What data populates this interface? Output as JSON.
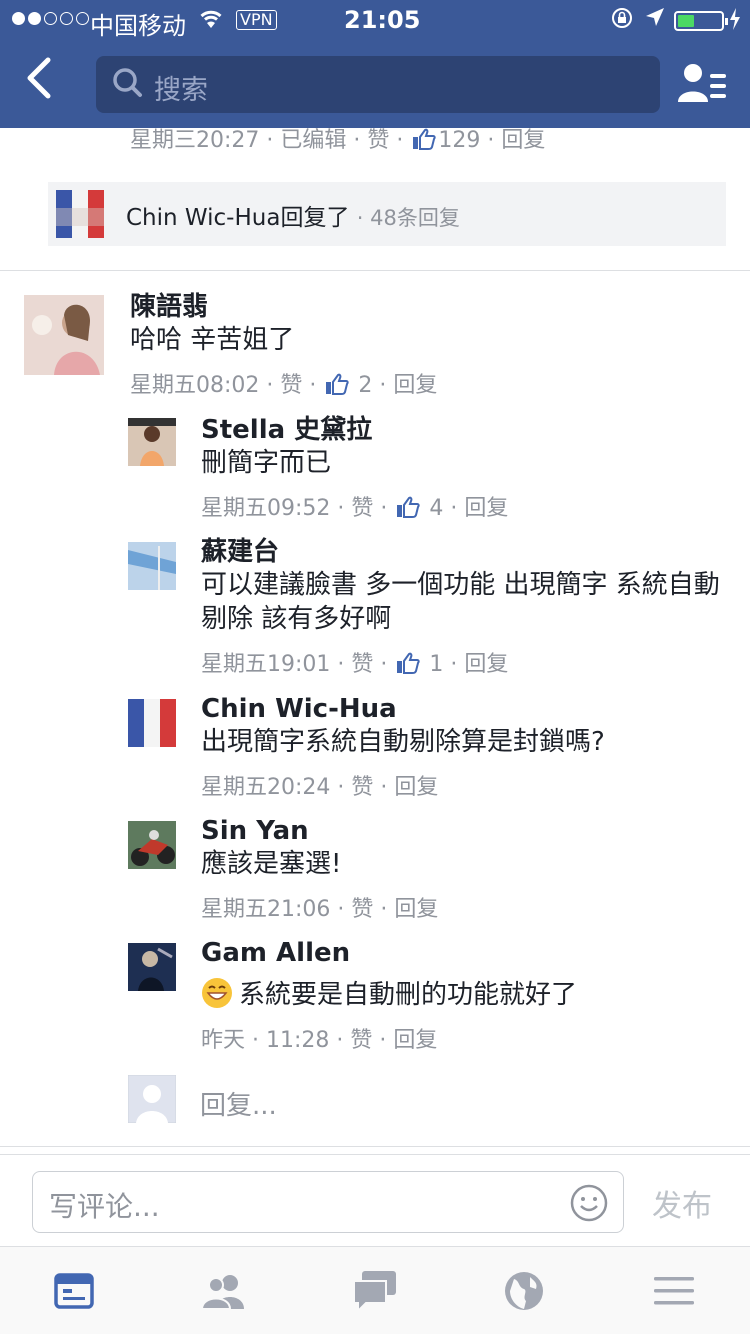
{
  "status_bar": {
    "carrier": "中国移动",
    "vpn": "VPN",
    "time": "21:05",
    "battery_level": 0.3,
    "signal_bars_filled": 2,
    "signal_bars_total": 5
  },
  "header": {
    "back_icon": "chevron-left-icon",
    "search_placeholder": "搜索",
    "friend_requests_icon": "friend-requests-icon"
  },
  "top_comment_meta": {
    "time": "星期三20:27",
    "edited": "已编辑",
    "like": "赞",
    "likes": "129",
    "reply": "回复",
    "sep": " · "
  },
  "collapsed_reply": {
    "name": "Chin Wic-Hua",
    "action": "回复了",
    "count": "48条回复"
  },
  "comments": [
    {
      "name": "陳語翡",
      "text": "哈哈 辛苦姐了",
      "time": "星期五08:02",
      "like": "赞",
      "likes": "2",
      "reply": "回复"
    },
    {
      "name": "Stella 史黛拉",
      "text": "刪簡字而已",
      "time": "星期五09:52",
      "like": "赞",
      "likes": "4",
      "reply": "回复"
    },
    {
      "name": "蘇建台",
      "text": "可以建議臉書 多一個功能 出現簡字 系統自動剔除 該有多好啊",
      "time": "星期五19:01",
      "like": "赞",
      "likes": "1",
      "reply": "回复"
    },
    {
      "name": "Chin Wic-Hua",
      "text": "出現簡字系統自動剔除算是封鎖嗎?",
      "time": "星期五20:24",
      "like": "赞",
      "reply": "回复"
    },
    {
      "name": "Sin Yan",
      "text": "應該是塞選!",
      "time": "星期五21:06",
      "like": "赞",
      "reply": "回复"
    },
    {
      "name": "Gam Allen",
      "text": "系統要是自動刪的功能就好了",
      "time": "昨天 · 11:28",
      "like": "赞",
      "reply": "回复"
    }
  ],
  "reply_input": {
    "placeholder": "回复..."
  },
  "composer": {
    "placeholder": "写评论...",
    "publish": "发布"
  },
  "tabbar": {
    "items": [
      "news-feed-icon",
      "friends-icon",
      "messages-icon",
      "notifications-globe-icon",
      "menu-icon"
    ],
    "active": 0
  },
  "colors": {
    "brand": "#3b5998",
    "meta": "#90949c",
    "thumb": "#4267b2"
  }
}
